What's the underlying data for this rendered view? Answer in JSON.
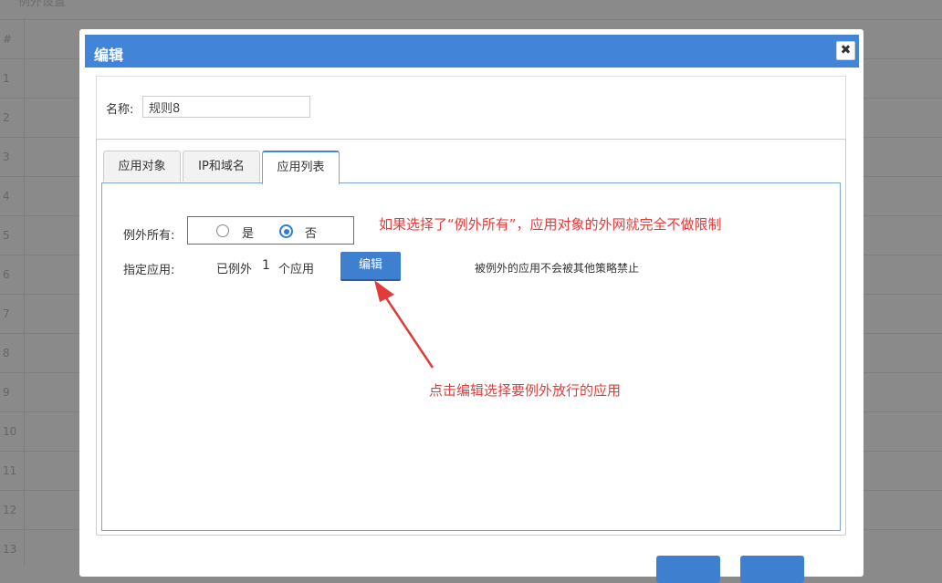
{
  "background": {
    "title": "例外设置",
    "header": "#",
    "rows": [
      "1",
      "2",
      "3",
      "4",
      "5",
      "6",
      "7",
      "8",
      "9",
      "10",
      "11",
      "12",
      "13"
    ]
  },
  "dialog": {
    "title": "编辑",
    "close": "✖",
    "name_label": "名称:",
    "name_value": "规则8",
    "tabs": [
      {
        "label": "应用对象"
      },
      {
        "label": "IP和域名"
      },
      {
        "label": "应用列表"
      }
    ],
    "exception_all_label": "例外所有:",
    "option_yes": "是",
    "option_no": "否",
    "selected": "否",
    "specify_label": "指定应用:",
    "excepted_prefix": "已例外",
    "excepted_count": "1",
    "excepted_suffix": "个应用",
    "edit_button": "编辑",
    "note": "被例外的应用不会被其他策略禁止"
  },
  "annotations": {
    "top": "如果选择了“例外所有”，应用对象的外网就完全不做限制",
    "bottom": "点击编辑选择要例外放行的应用"
  },
  "colors": {
    "accent": "#4285d8",
    "annotation": "#e23b3b"
  }
}
